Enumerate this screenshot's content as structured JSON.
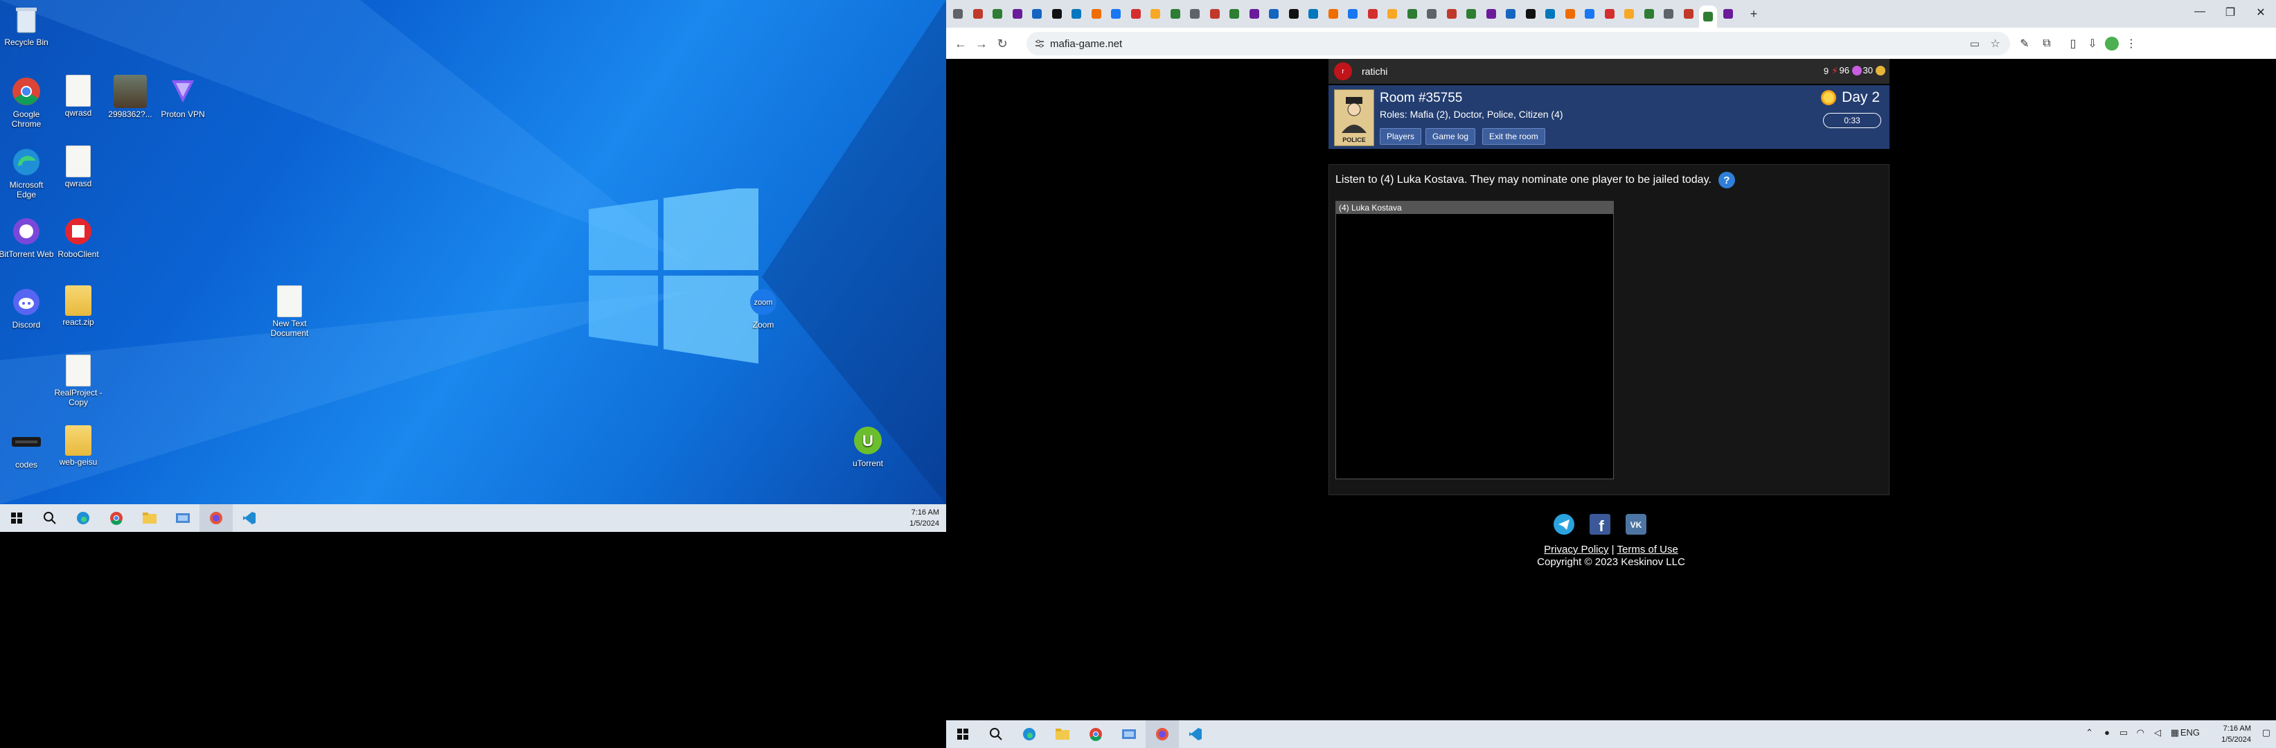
{
  "left_monitor": {
    "desktop_icons": [
      {
        "label": "Recycle Bin",
        "icon": "recycle-bin-icon"
      },
      {
        "label": "Google Chrome",
        "icon": "chrome-icon"
      },
      {
        "label": "qwrasd",
        "icon": "file-icon"
      },
      {
        "label": "2998362?...",
        "icon": "photo-icon"
      },
      {
        "label": "Proton VPN",
        "icon": "proton-vpn-icon"
      },
      {
        "label": "Microsoft Edge",
        "icon": "edge-icon"
      },
      {
        "label": "qwrasd",
        "icon": "file-icon"
      },
      {
        "label": "BitTorrent Web",
        "icon": "bittorrent-icon"
      },
      {
        "label": "RoboClient",
        "icon": "roboclient-icon"
      },
      {
        "label": "Discord",
        "icon": "discord-icon"
      },
      {
        "label": "react.zip",
        "icon": "folder-icon"
      },
      {
        "label": "New Text Document",
        "icon": "file-icon"
      },
      {
        "label": "Zoom",
        "icon": "zoom-icon"
      },
      {
        "label": "RealProject - Copy",
        "icon": "file-icon"
      },
      {
        "label": "codes",
        "icon": "app-icon"
      },
      {
        "label": "web-geisu",
        "icon": "folder-icon"
      },
      {
        "label": "uTorrent",
        "icon": "utorrent-icon"
      }
    ],
    "clock": {
      "time": "7:16 AM",
      "date": "1/5/2024"
    }
  },
  "browser": {
    "tab_count": 40,
    "url": "mafia-game.net",
    "window_controls": [
      "—",
      "❐",
      "✕"
    ]
  },
  "game": {
    "user": {
      "avatar_letter": "r",
      "username": "ratichi"
    },
    "stats": {
      "energy": "9",
      "gems": "96",
      "coins": "30"
    },
    "room": {
      "title": "Room #35755",
      "roles": "Roles: Mafia (2), Doctor, Police, Citizen (4)",
      "card_label": "POLICE",
      "buttons": [
        "Players",
        "Game log",
        "Exit the room"
      ]
    },
    "phase": {
      "day": "Day 2",
      "timer": "0:33"
    },
    "instruction": "Listen to (4) Luka Kostava. They may nominate one player to be jailed today.",
    "help": "?",
    "chat_header": "(4) Luka Kostava"
  },
  "footer": {
    "socials": [
      "telegram-icon",
      "facebook-icon",
      "vk-icon"
    ],
    "privacy": "Privacy Policy",
    "separator": "|",
    "terms": "Terms of Use",
    "copyright": "Copyright © 2023 Keskinov LLC"
  },
  "right_taskbar": {
    "lang": "ENG",
    "clock": {
      "time": "7:16 AM",
      "date": "1/5/2024"
    }
  },
  "colors": {
    "room_blue": "#233d70",
    "desktop_blue": "#0b63d3",
    "taskbar": "#dfe6ee"
  }
}
